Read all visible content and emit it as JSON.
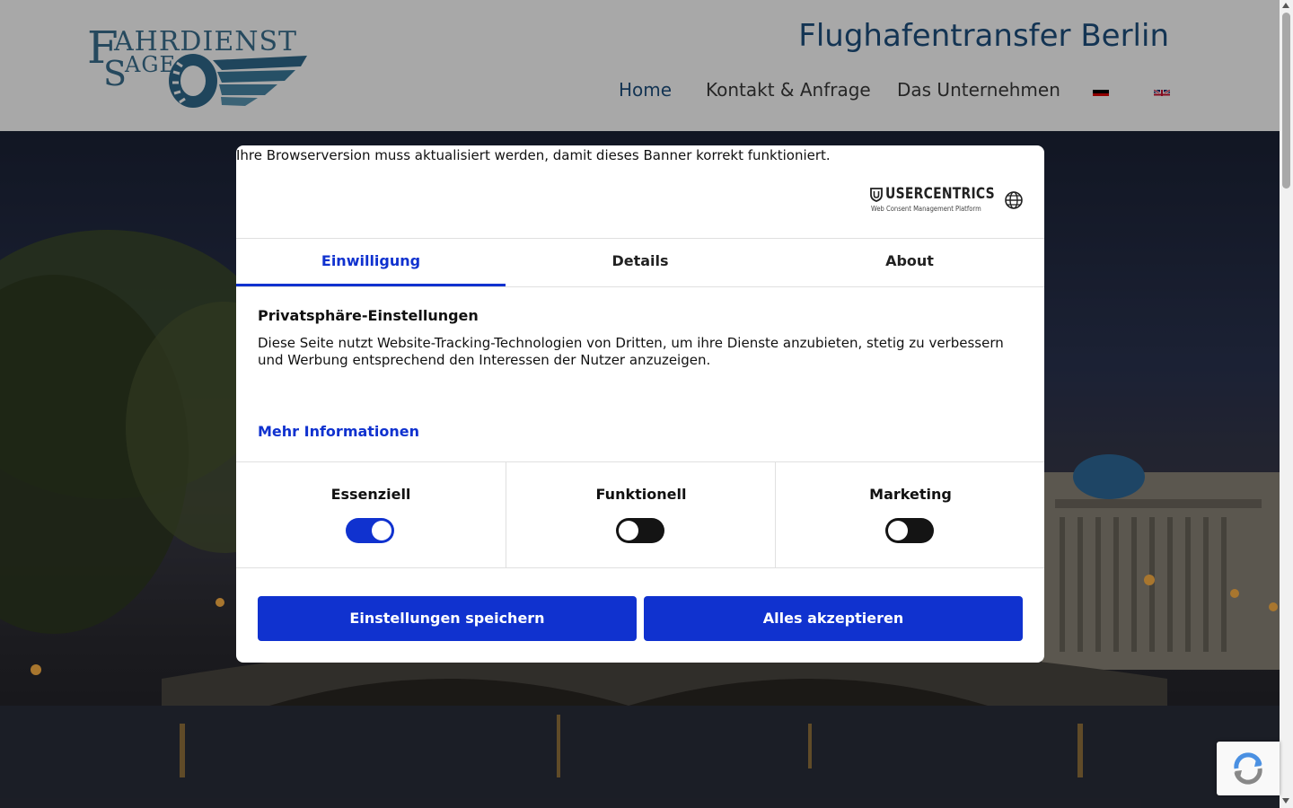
{
  "site": {
    "tagline": "Flughafentransfer Berlin",
    "logo": {
      "line1": "AHRDIENST",
      "line2": "AGE",
      "initial1": "F",
      "initial2": "S"
    },
    "nav": [
      {
        "label": "Home",
        "active": true
      },
      {
        "label": "Kontakt & Anfrage",
        "active": false
      },
      {
        "label": "Das Unternehmen",
        "active": false
      }
    ],
    "flags": [
      "german-flag-icon",
      "uk-flag-icon"
    ]
  },
  "consent": {
    "browser_warning": "Ihre Browserversion muss aktualisiert werden, damit dieses Banner korrekt funktioniert.",
    "brand": {
      "name": "USERCENTRICS",
      "subtitle": "Web Consent Management Platform"
    },
    "tabs": [
      {
        "label": "Einwilligung",
        "active": true
      },
      {
        "label": "Details",
        "active": false
      },
      {
        "label": "About",
        "active": false
      }
    ],
    "title": "Privatsphäre-Einstellungen",
    "description": "Diese Seite nutzt Website-Tracking-Technologien von Dritten, um ihre Dienste anzubieten, stetig zu verbessern und Werbung entsprechend den Interessen der Nutzer anzuzeigen.",
    "more_info": "Mehr Informationen",
    "categories": [
      {
        "label": "Essenziell",
        "enabled": true
      },
      {
        "label": "Funktionell",
        "enabled": false
      },
      {
        "label": "Marketing",
        "enabled": false
      }
    ],
    "buttons": {
      "save": "Einstellungen speichern",
      "accept_all": "Alles akzeptieren"
    }
  },
  "colors": {
    "accent": "#1032cf",
    "brand_blue": "#1e4f7f"
  }
}
